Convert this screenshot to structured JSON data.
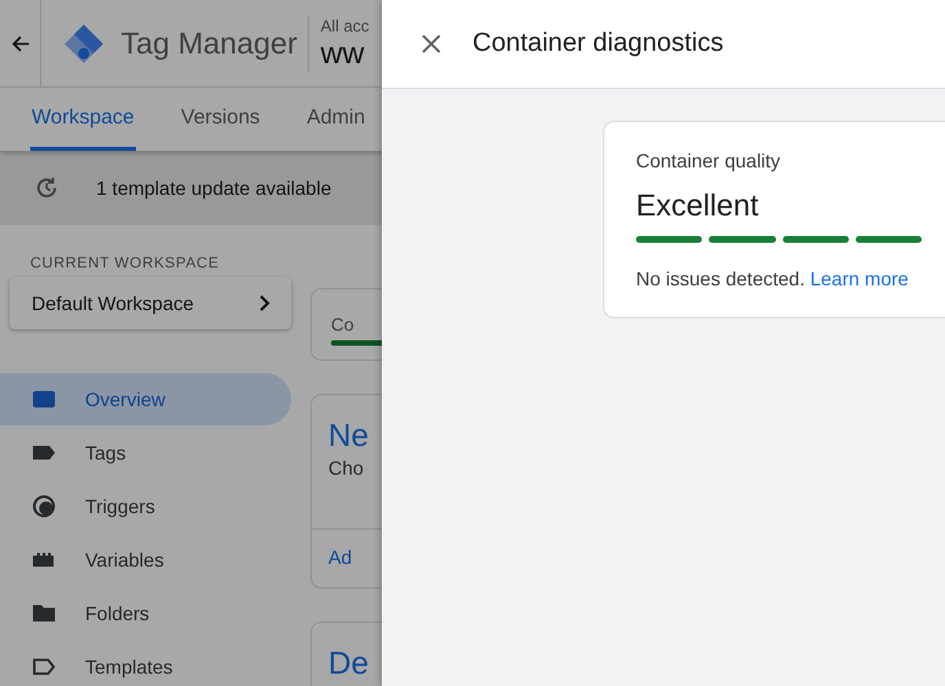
{
  "header": {
    "product": "Tag Manager",
    "account_label": "All acc",
    "container_name": "ww"
  },
  "tabs": [
    {
      "label": "Workspace",
      "selected": true
    },
    {
      "label": "Versions",
      "selected": false
    },
    {
      "label": "Admin",
      "selected": false
    }
  ],
  "notice": "1 template update available",
  "workspace": {
    "label": "CURRENT WORKSPACE",
    "name": "Default Workspace"
  },
  "nav": [
    {
      "label": "Overview",
      "selected": true
    },
    {
      "label": "Tags",
      "selected": false
    },
    {
      "label": "Triggers",
      "selected": false
    },
    {
      "label": "Variables",
      "selected": false
    },
    {
      "label": "Folders",
      "selected": false
    },
    {
      "label": "Templates",
      "selected": false
    }
  ],
  "cards": [
    {
      "kind": "status",
      "title": "Co"
    },
    {
      "kind": "new",
      "title": "Ne",
      "text": "Cho",
      "link": "Ad"
    },
    {
      "kind": "heading",
      "title": "De"
    }
  ],
  "panel": {
    "title": "Container diagnostics",
    "quality": {
      "label": "Container quality",
      "rating": "Excellent",
      "message": "No issues detected.",
      "link": "Learn more"
    }
  }
}
